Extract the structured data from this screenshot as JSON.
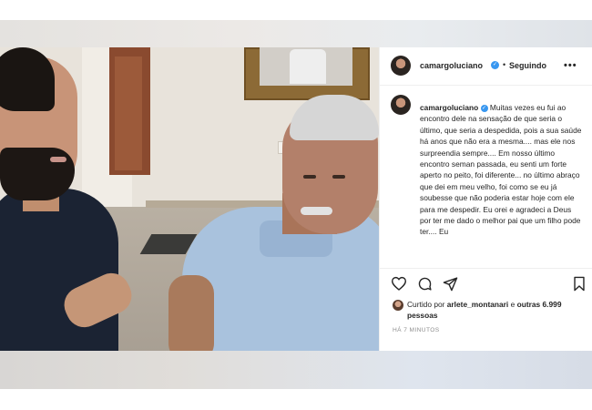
{
  "post": {
    "author": "camargoluciano",
    "verified_glyph": "✓",
    "separator": "•",
    "follow_label": "Seguindo",
    "more_label": "•••",
    "caption_text": "Muitas vezes eu fui ao encontro dele na sensação de que seria o último, que seria a despedida, pois a sua saúde há anos que não era a mesma.... mas ele nos surpreendia sempre.... Em nosso último encontro seman passada, eu senti um forte aperto no peito, foi diferente... no último abraço que dei em meu velho, foi como se eu já soubesse que não poderia estar hoje com ele para me despedir. Eu orei e agradeci a Deus por ter me dado o melhor pai que um filho pode ter.... Eu",
    "likes_prefix": "Curtido por",
    "liked_by_user": "arlete_montanari",
    "likes_joiner": "e",
    "likes_count": "outras 6.999 pessoas",
    "timestamp": "HÁ 7 MINUTOS"
  },
  "icons": {
    "like": "heart-icon",
    "comment": "comment-icon",
    "share": "share-icon",
    "save": "bookmark-icon",
    "verified": "verified-badge-icon"
  },
  "colors": {
    "verified_blue": "#3897f0",
    "text": "#262626",
    "muted": "#8e8e8e"
  }
}
